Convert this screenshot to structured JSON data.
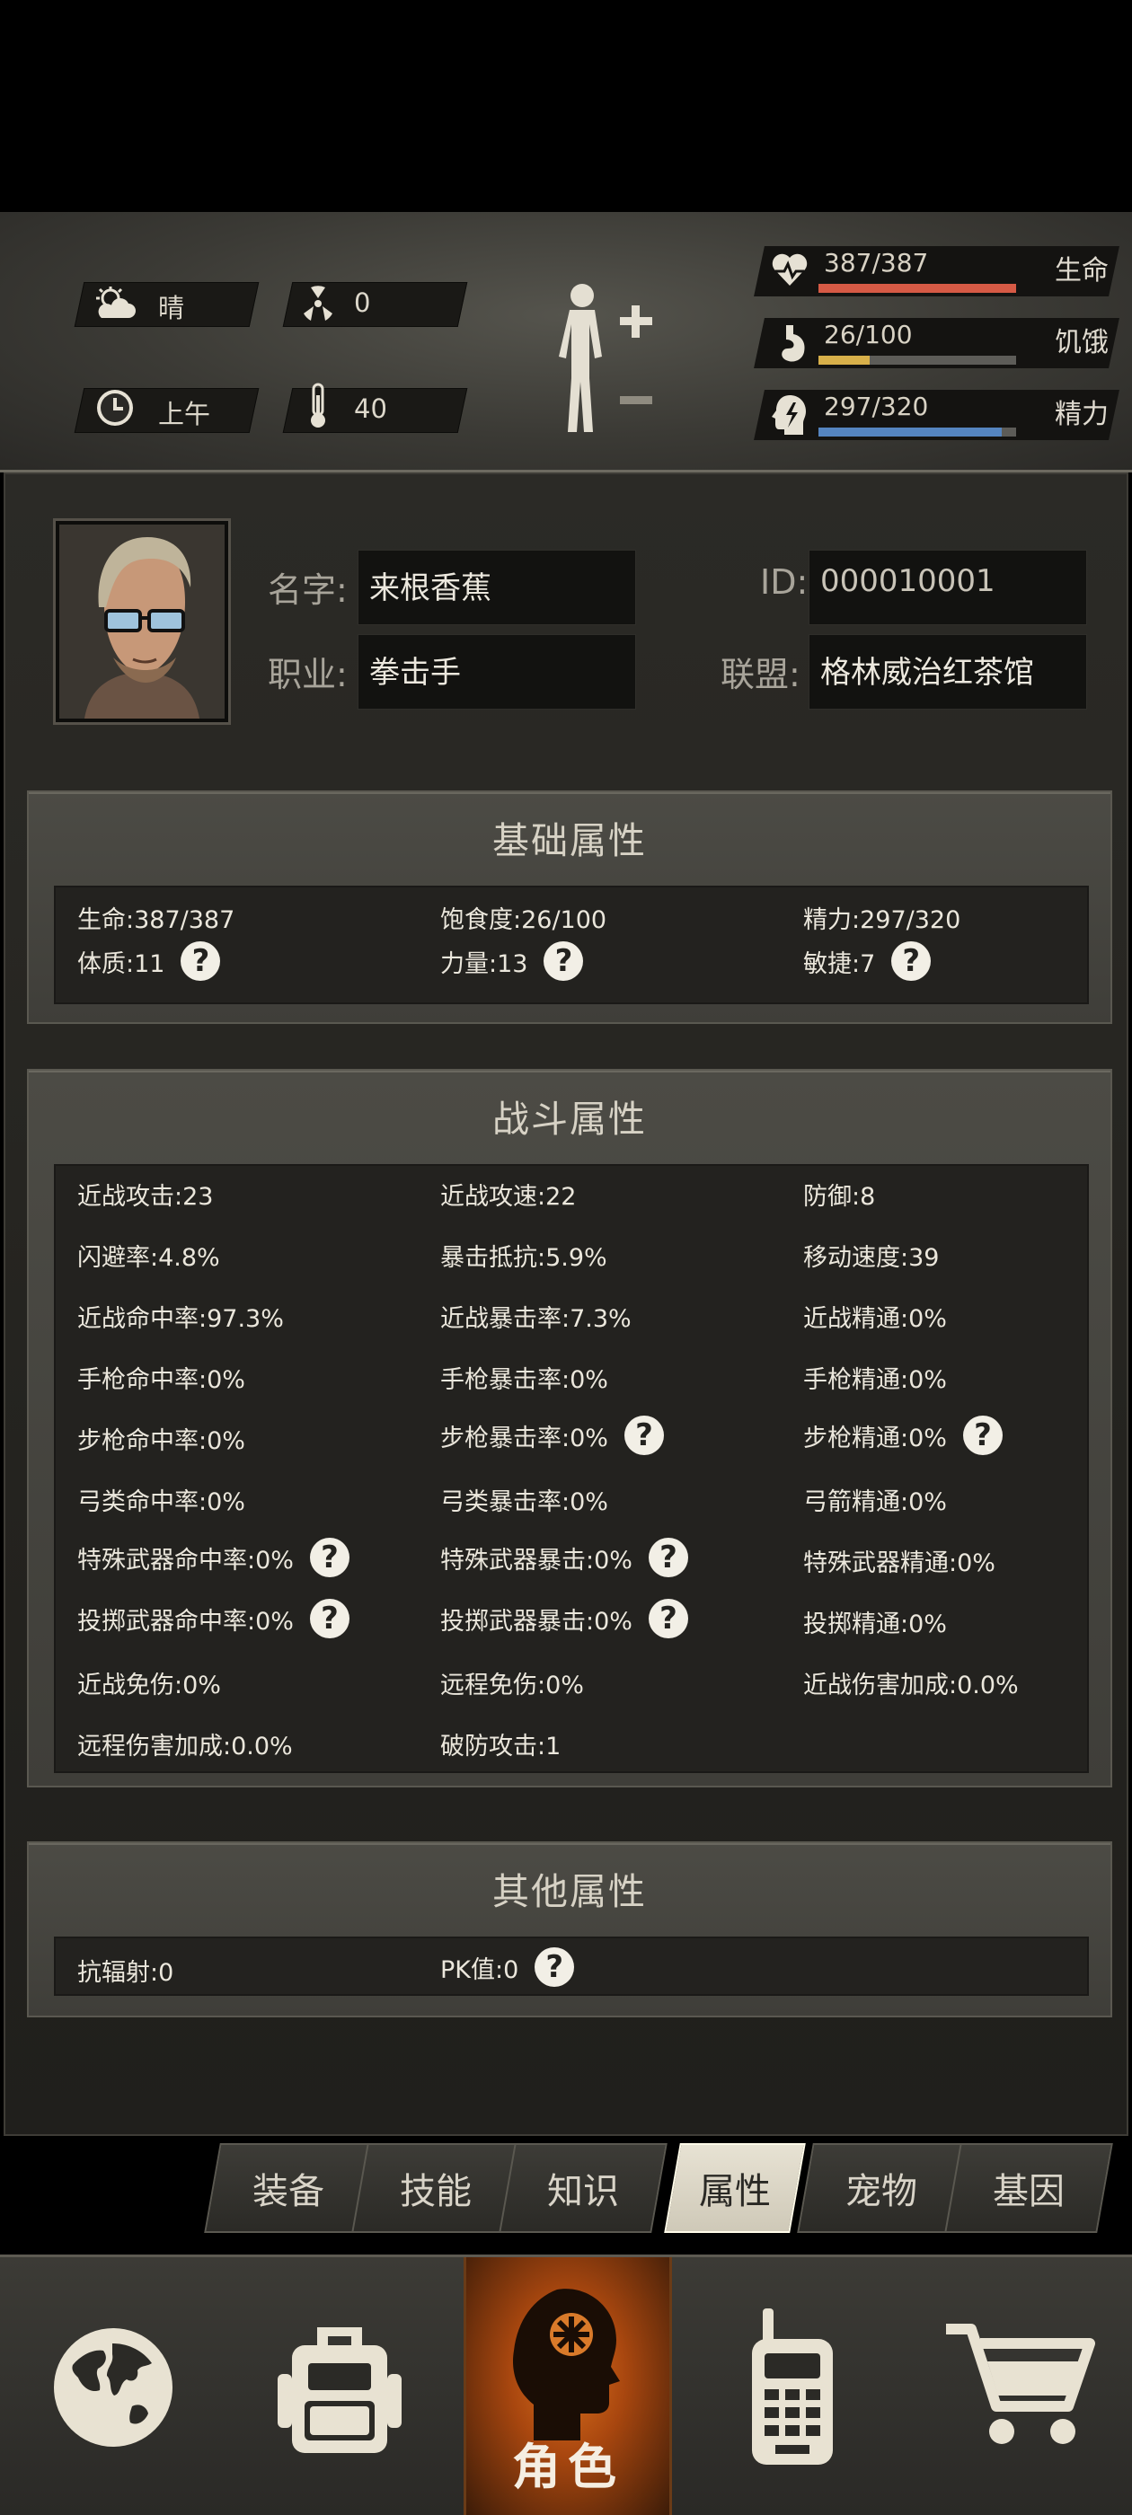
{
  "status": {
    "weather": {
      "icon": "partly-cloudy-icon",
      "label": "晴"
    },
    "radiation": {
      "icon": "radiation-icon",
      "value": "0"
    },
    "time": {
      "icon": "clock-icon",
      "label": "上午"
    },
    "temperature": {
      "icon": "thermometer-icon",
      "value": "40"
    },
    "vitals": [
      {
        "icon": "heartbeat-icon",
        "value": "387/387",
        "label": "生命",
        "fraction": 1.0,
        "color": "#d65a45"
      },
      {
        "icon": "stomach-icon",
        "value": "26/100",
        "label": "饥饿",
        "fraction": 0.26,
        "color": "#d8b04a"
      },
      {
        "icon": "energy-head-icon",
        "value": "297/320",
        "label": "精力",
        "fraction": 0.928,
        "color": "#5585c0"
      }
    ]
  },
  "profile": {
    "name_label": "名字:",
    "name": "来根香蕉",
    "id_label": "ID:",
    "id": "000010001",
    "job_label": "职业:",
    "job": "拳击手",
    "alliance_label": "联盟:",
    "alliance": "格林威治红茶馆"
  },
  "basic": {
    "title": "基础属性",
    "rows": [
      [
        "生命:387/387",
        "饱食度:26/100",
        "精力:297/320"
      ],
      [
        "体质:11",
        "力量:13",
        "敏捷:7"
      ]
    ]
  },
  "combat": {
    "title": "战斗属性",
    "rows": [
      [
        "近战攻击:23",
        "近战攻速:22",
        "防御:8"
      ],
      [
        "闪避率:4.8%",
        "暴击抵抗:5.9%",
        "移动速度:39"
      ],
      [
        "近战命中率:97.3%",
        "近战暴击率:7.3%",
        "近战精通:0%"
      ],
      [
        "手枪命中率:0%",
        "手枪暴击率:0%",
        "手枪精通:0%"
      ],
      [
        "步枪命中率:0%",
        "步枪暴击率:0%",
        "步枪精通:0%"
      ],
      [
        "弓类命中率:0%",
        "弓类暴击率:0%",
        "弓箭精通:0%"
      ],
      [
        "特殊武器命中率:0%",
        "特殊武器暴击:0%",
        "特殊武器精通:0%"
      ],
      [
        "投掷武器命中率:0%",
        "投掷武器暴击:0%",
        "投掷精通:0%"
      ],
      [
        "近战免伤:0%",
        "远程免伤:0%",
        "近战伤害加成:0.0%"
      ],
      [
        "远程伤害加成:0.0%",
        "破防攻击:1",
        ""
      ]
    ]
  },
  "other": {
    "title": "其他属性",
    "rows": [
      [
        "抗辐射:0",
        "PK值:0",
        ""
      ]
    ]
  },
  "help_glyph": "?",
  "tabs": [
    "装备",
    "技能",
    "知识",
    "属性",
    "宠物",
    "基因"
  ],
  "active_tab": "属性",
  "nav": {
    "items": [
      "globe-icon",
      "backpack-icon",
      "character-icon",
      "radio-icon",
      "cart-icon"
    ],
    "active_label": "角色"
  }
}
